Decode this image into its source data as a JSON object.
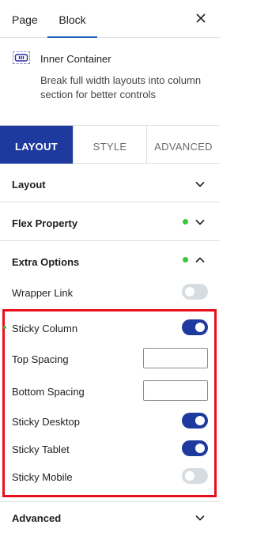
{
  "tabs": {
    "page_label": "Page",
    "block_label": "Block"
  },
  "block": {
    "name": "Inner Container",
    "description": "Break full width layouts into column section for better controls"
  },
  "subtabs": {
    "layout": "LAYOUT",
    "style": "STYLE",
    "advanced": "ADVANCED"
  },
  "panels": {
    "layout": "Layout",
    "flex_property": "Flex Property",
    "extra_options": "Extra Options",
    "advanced": "Advanced"
  },
  "extra_options": {
    "wrapper_link": {
      "label": "Wrapper Link",
      "on": false
    },
    "sticky_column": {
      "label": "Sticky Column",
      "on": true
    },
    "top_spacing": {
      "label": "Top Spacing",
      "value": ""
    },
    "bottom_spacing": {
      "label": "Bottom Spacing",
      "value": ""
    },
    "sticky_desktop": {
      "label": "Sticky Desktop",
      "on": true
    },
    "sticky_tablet": {
      "label": "Sticky Tablet",
      "on": true
    },
    "sticky_mobile": {
      "label": "Sticky Mobile",
      "on": false
    }
  },
  "colors": {
    "accent": "#1e3a9e",
    "tab_underline": "#1e5fbd",
    "status_dot": "#3ac73a",
    "highlight": "#e8101c",
    "toggle_off": "#d6dde2"
  },
  "icons": {
    "close": "close-icon",
    "block": "inner-container-icon",
    "chevron_down": "chevron-down-icon",
    "chevron_up": "chevron-up-icon"
  }
}
